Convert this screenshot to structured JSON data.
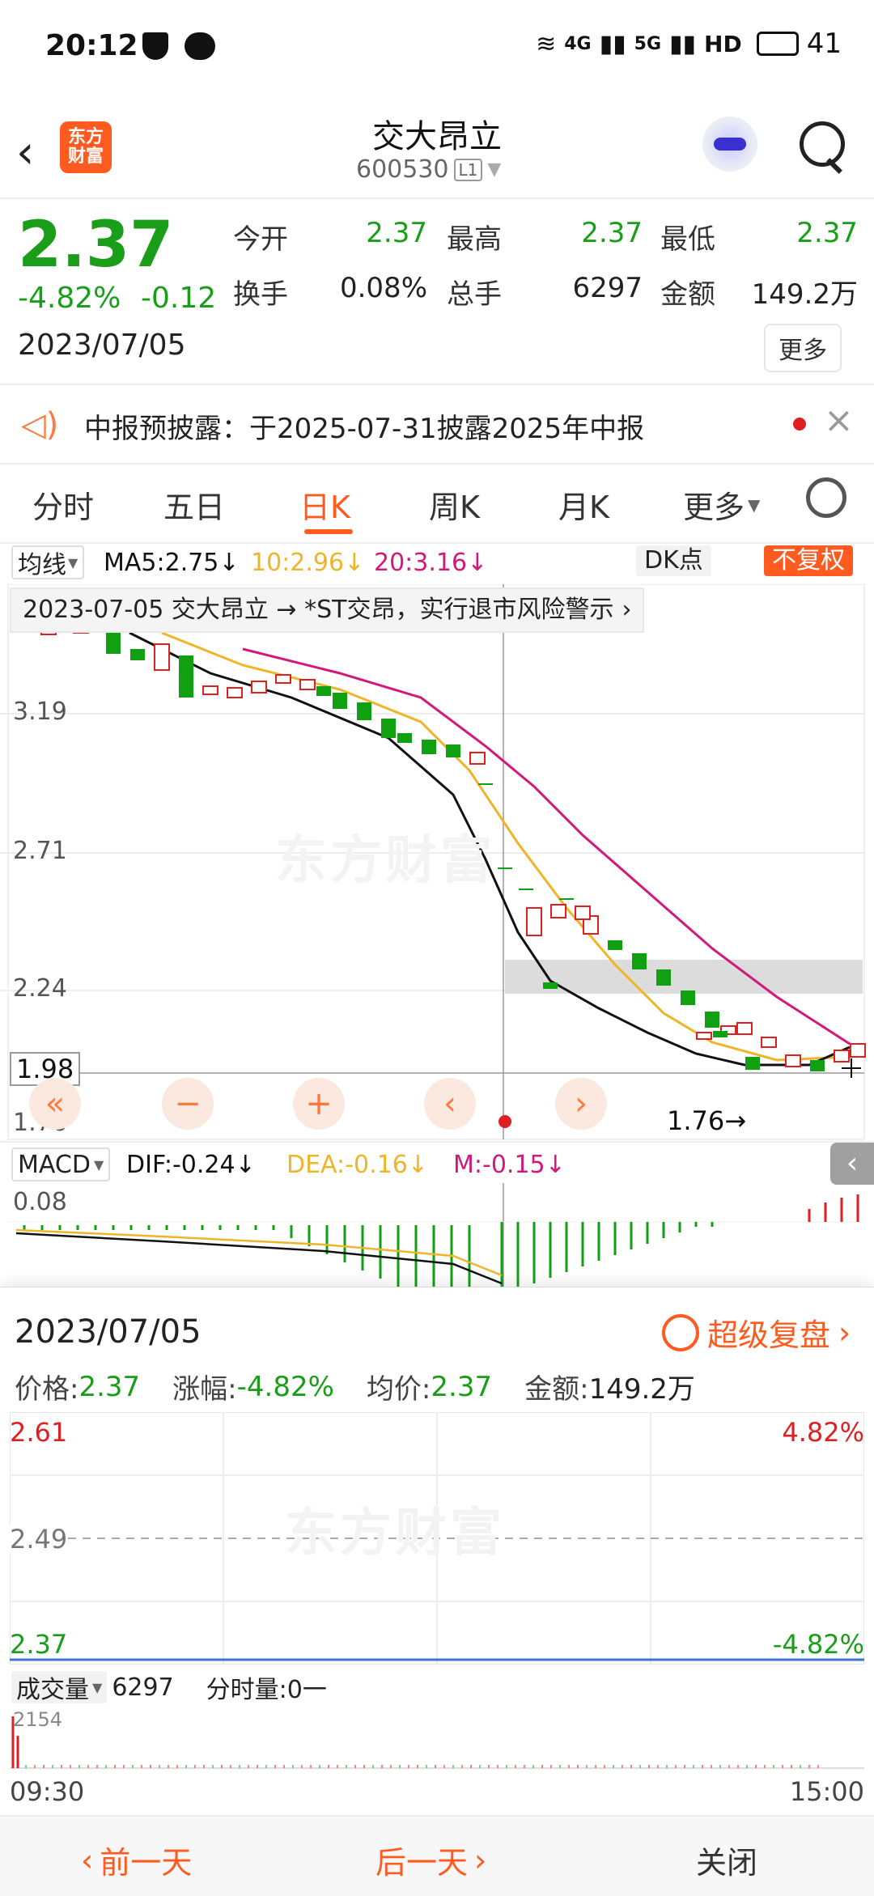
{
  "status": {
    "time": "20:12",
    "net1": "4G",
    "net2": "5G",
    "hd": "HD",
    "battery": "41"
  },
  "header": {
    "logo_top": "东方",
    "logo_bottom": "财富",
    "title": "交大昂立",
    "code": "600530",
    "level": "L1"
  },
  "quote": {
    "price": "2.37",
    "change_pct": "-4.82%",
    "change": "-0.12",
    "date": "2023/07/05",
    "open_label": "今开",
    "open": "2.37",
    "high_label": "最高",
    "high": "2.37",
    "low_label": "最低",
    "low": "2.37",
    "turnover_label": "换手",
    "turnover": "0.08%",
    "volume_label": "总手",
    "volume": "6297",
    "amount_label": "金额",
    "amount": "149.2万",
    "more": "更多"
  },
  "notice": {
    "text": "中报预披露：于2025-07-31披露2025年中报"
  },
  "tabs": [
    "分时",
    "五日",
    "日K",
    "周K",
    "月K",
    "更多"
  ],
  "kline": {
    "ma_selector": "均线",
    "ma5": "MA5:2.75",
    "ma10": "10:2.96",
    "ma20": "20:3.16",
    "dk": "DK点",
    "fuquan": "不复权",
    "event": "2023-07-05 交大昂立 → *ST交昂，实行退市风险警示",
    "watermark": "东方财富",
    "y_labels": [
      "3.19",
      "2.71",
      "2.24",
      "1.98",
      "1.76"
    ],
    "min_marker": "1.76",
    "colors": {
      "up": "#e02020",
      "down": "#11a011",
      "ma5": "#111111",
      "ma10": "#f0b429",
      "ma20": "#d4187a"
    }
  },
  "macd": {
    "selector": "MACD",
    "dif": "DIF:-0.24",
    "dea": "DEA:-0.16",
    "m": "M:-0.15",
    "top_value": "0.08"
  },
  "detail": {
    "date": "2023/07/05",
    "replay": "超级复盘",
    "price_label": "价格:",
    "price": "2.37",
    "pct_label": "涨幅:",
    "pct": "-4.82%",
    "avg_label": "均价:",
    "avg": "2.37",
    "amount_label": "金额:",
    "amount": "149.2万"
  },
  "intraday": {
    "top_price": "2.61",
    "mid_price": "2.49",
    "bottom_price": "2.37",
    "top_pct": "4.82%",
    "bottom_pct": "-4.82%",
    "watermark": "东方财富",
    "vol_selector": "成交量",
    "vol_value": "6297",
    "tick_label": "分时量:0一",
    "vol_max": "2154",
    "start_time": "09:30",
    "end_time": "15:00"
  },
  "bottom": {
    "prev": "前一天",
    "next": "后一天",
    "close": "关闭"
  }
}
